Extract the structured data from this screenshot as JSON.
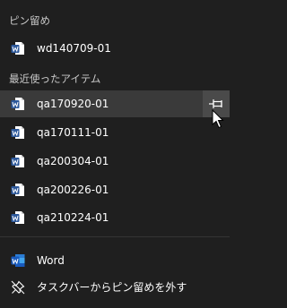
{
  "pinned": {
    "header": "ピン留め",
    "items": [
      {
        "label": "wd140709-01",
        "icon": "word-doc-icon"
      }
    ]
  },
  "recent": {
    "header": "最近使ったアイテム",
    "items": [
      {
        "label": "qa170920-01",
        "icon": "word-doc-icon",
        "hovered": true
      },
      {
        "label": "qa170111-01",
        "icon": "word-doc-icon"
      },
      {
        "label": "qa200304-01",
        "icon": "word-doc-icon"
      },
      {
        "label": "qa200226-01",
        "icon": "word-doc-icon"
      },
      {
        "label": "qa210224-01",
        "icon": "word-doc-icon"
      }
    ],
    "pin_icon": "pin-icon"
  },
  "footer": {
    "app_label": "Word",
    "app_icon": "word-app-icon",
    "unpin_label": "タスクバーからピン留めを外す",
    "unpin_icon": "unpin-icon"
  },
  "colors": {
    "background": "#1f1f1f",
    "hover": "#3a3a3a",
    "pin_button": "#4a4a4a",
    "word_blue": "#2b579a",
    "header_text": "#c9c9c9"
  }
}
